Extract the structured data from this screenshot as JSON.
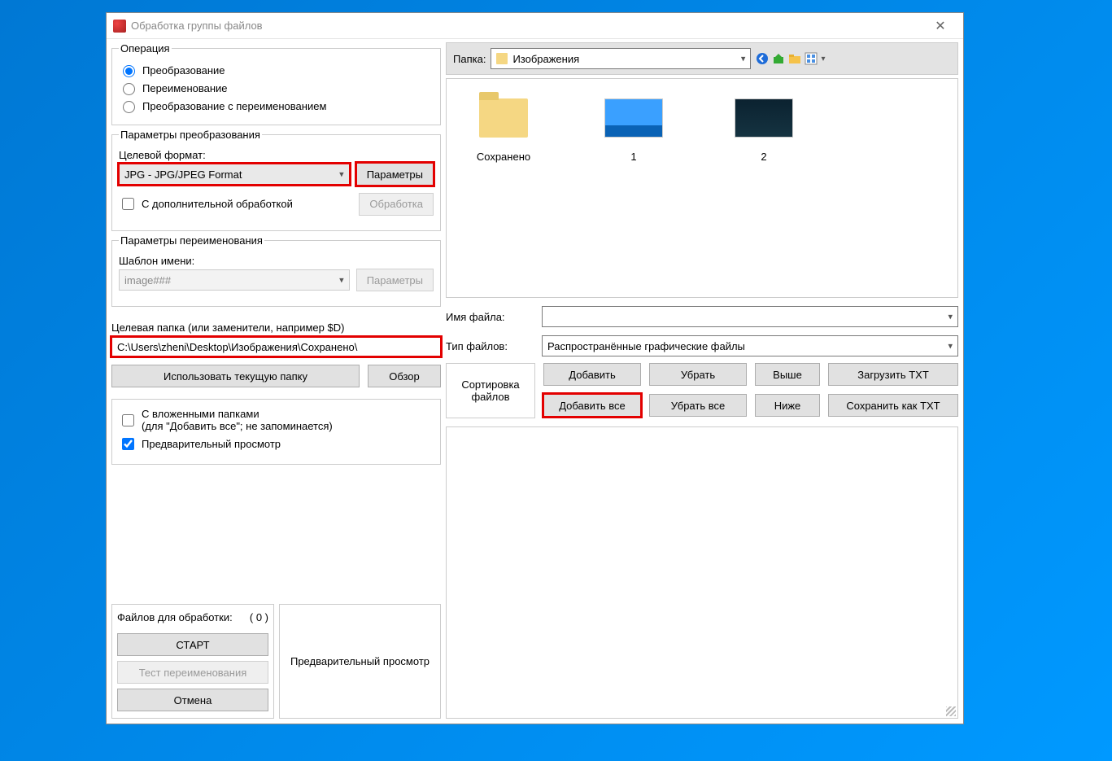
{
  "window": {
    "title": "Обработка группы файлов"
  },
  "operation": {
    "legend": "Операция",
    "opt_convert": "Преобразование",
    "opt_rename": "Переименование",
    "opt_both": "Преобразование с переименованием"
  },
  "convert": {
    "legend": "Параметры преобразования",
    "target_format_label": "Целевой формат:",
    "target_format_value": "JPG - JPG/JPEG Format",
    "params_btn": "Параметры",
    "extra_processing": "С дополнительной обработкой",
    "processing_btn": "Обработка"
  },
  "rename": {
    "legend": "Параметры переименования",
    "name_template_label": "Шаблон имени:",
    "name_template_value": "image###",
    "params_btn": "Параметры"
  },
  "target": {
    "label": "Целевая папка (или заменители, например $D)",
    "path": "C:\\Users\\zheni\\Desktop\\Изображения\\Сохранено\\",
    "use_current_btn": "Использовать текущую папку",
    "browse_btn": "Обзор"
  },
  "subdirs": {
    "with_sub_label": "С вложенными папками",
    "with_sub_note": "(для \"Добавить все\"; не запоминается)",
    "preview_label": "Предварительный просмотр"
  },
  "run": {
    "files_for": "Файлов для обработки:",
    "count": "( 0 )",
    "start_btn": "СТАРТ",
    "test_rename_btn": "Тест переименования",
    "cancel_btn": "Отмена",
    "preview_label": "Предварительный просмотр"
  },
  "browser": {
    "folder_label": "Папка:",
    "folder_value": "Изображения",
    "items": [
      {
        "name": "Сохранено",
        "type": "folder"
      },
      {
        "name": "1",
        "type": "image1"
      },
      {
        "name": "2",
        "type": "image2"
      }
    ]
  },
  "fields": {
    "filename_label": "Имя файла:",
    "filename_value": "",
    "filetype_label": "Тип файлов:",
    "filetype_value": "Распространённые графические файлы"
  },
  "actions": {
    "sort_label": "Сортировка файлов",
    "add": "Добавить",
    "remove": "Убрать",
    "up": "Выше",
    "load_txt": "Загрузить TXT",
    "add_all": "Добавить все",
    "remove_all": "Убрать все",
    "down": "Ниже",
    "save_txt": "Сохранить как TXT"
  }
}
